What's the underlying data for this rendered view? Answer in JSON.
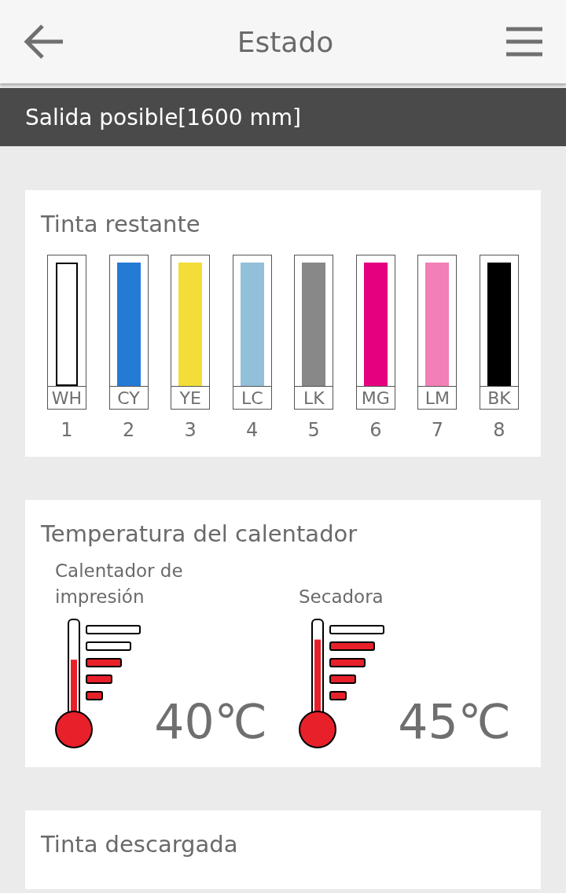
{
  "header": {
    "title": "Estado"
  },
  "output_bar": {
    "text": "Salida posible[1600 mm]"
  },
  "ink": {
    "title": "Tinta restante",
    "cartridges": [
      {
        "code": "WH",
        "number": "1",
        "color": "#ffffff"
      },
      {
        "code": "CY",
        "number": "2",
        "color": "#247bd6"
      },
      {
        "code": "YE",
        "number": "3",
        "color": "#f4dd38"
      },
      {
        "code": "LC",
        "number": "4",
        "color": "#92bfda"
      },
      {
        "code": "LK",
        "number": "5",
        "color": "#888888"
      },
      {
        "code": "MG",
        "number": "6",
        "color": "#e4007f"
      },
      {
        "code": "LM",
        "number": "7",
        "color": "#f27fb7"
      },
      {
        "code": "BK",
        "number": "8",
        "color": "#000000"
      }
    ]
  },
  "heaters": {
    "title": "Temperatura del calentador",
    "items": [
      {
        "name": "Calentador de impresión",
        "reading": "40℃",
        "level": 0.6
      },
      {
        "name": "Secadora",
        "reading": "45℃",
        "level": 0.8
      }
    ]
  },
  "discharged": {
    "title": "Tinta descargada"
  }
}
